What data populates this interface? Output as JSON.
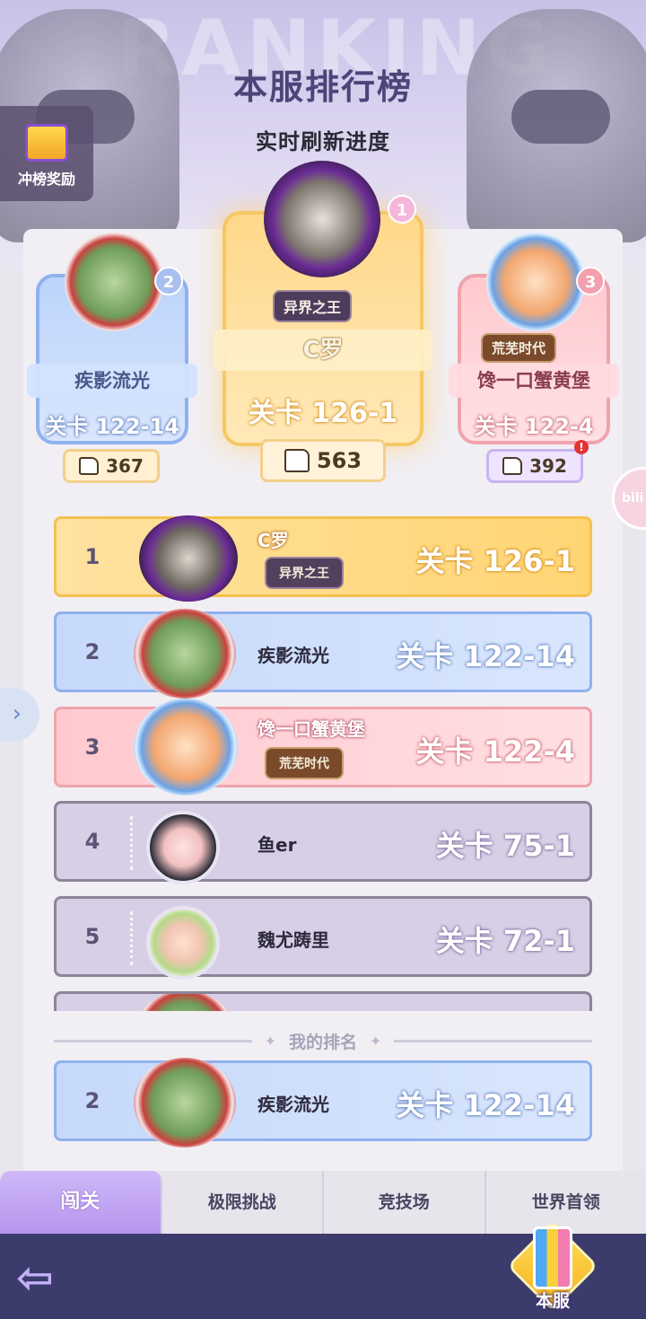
{
  "header": {
    "watermark": "RANKING",
    "title": "本服排行榜",
    "subtitle": "实时刷新进度",
    "reward_button": "冲榜奖励"
  },
  "podium": [
    {
      "rank": "1",
      "name": "C罗",
      "title": "异界之王",
      "stage": "关卡 126-1",
      "likes": "563"
    },
    {
      "rank": "2",
      "name": "疾影流光",
      "title": "",
      "stage": "关卡 122-14",
      "likes": "367"
    },
    {
      "rank": "3",
      "name": "馋一口蟹黄堡",
      "title": "荒芜时代",
      "stage": "关卡 122-4",
      "likes": "392"
    }
  ],
  "notification_badge": "!",
  "side_right_label": "bili",
  "side_left_icon": "›",
  "rows": [
    {
      "rank": "1",
      "name": "C罗",
      "title": "异界之王",
      "stage": "关卡 126-1"
    },
    {
      "rank": "2",
      "name": "疾影流光",
      "title": "",
      "stage": "关卡 122-14"
    },
    {
      "rank": "3",
      "name": "馋一口蟹黄堡",
      "title": "荒芜时代",
      "stage": "关卡 122-4"
    },
    {
      "rank": "4",
      "name": "鱼er",
      "title": "",
      "stage": "关卡 75-1"
    },
    {
      "rank": "5",
      "name": "魏尤踌里",
      "title": "",
      "stage": "关卡 72-1"
    }
  ],
  "my_rank": {
    "label": "我的排名",
    "rank": "2",
    "name": "疾影流光",
    "stage": "关卡 122-14"
  },
  "tabs": [
    {
      "label": "闯关",
      "active": true
    },
    {
      "label": "极限挑战",
      "active": false
    },
    {
      "label": "竞技场",
      "active": false
    },
    {
      "label": "世界首领",
      "active": false
    }
  ],
  "footer": {
    "back_icon": "⇦",
    "server_button": "本服"
  }
}
